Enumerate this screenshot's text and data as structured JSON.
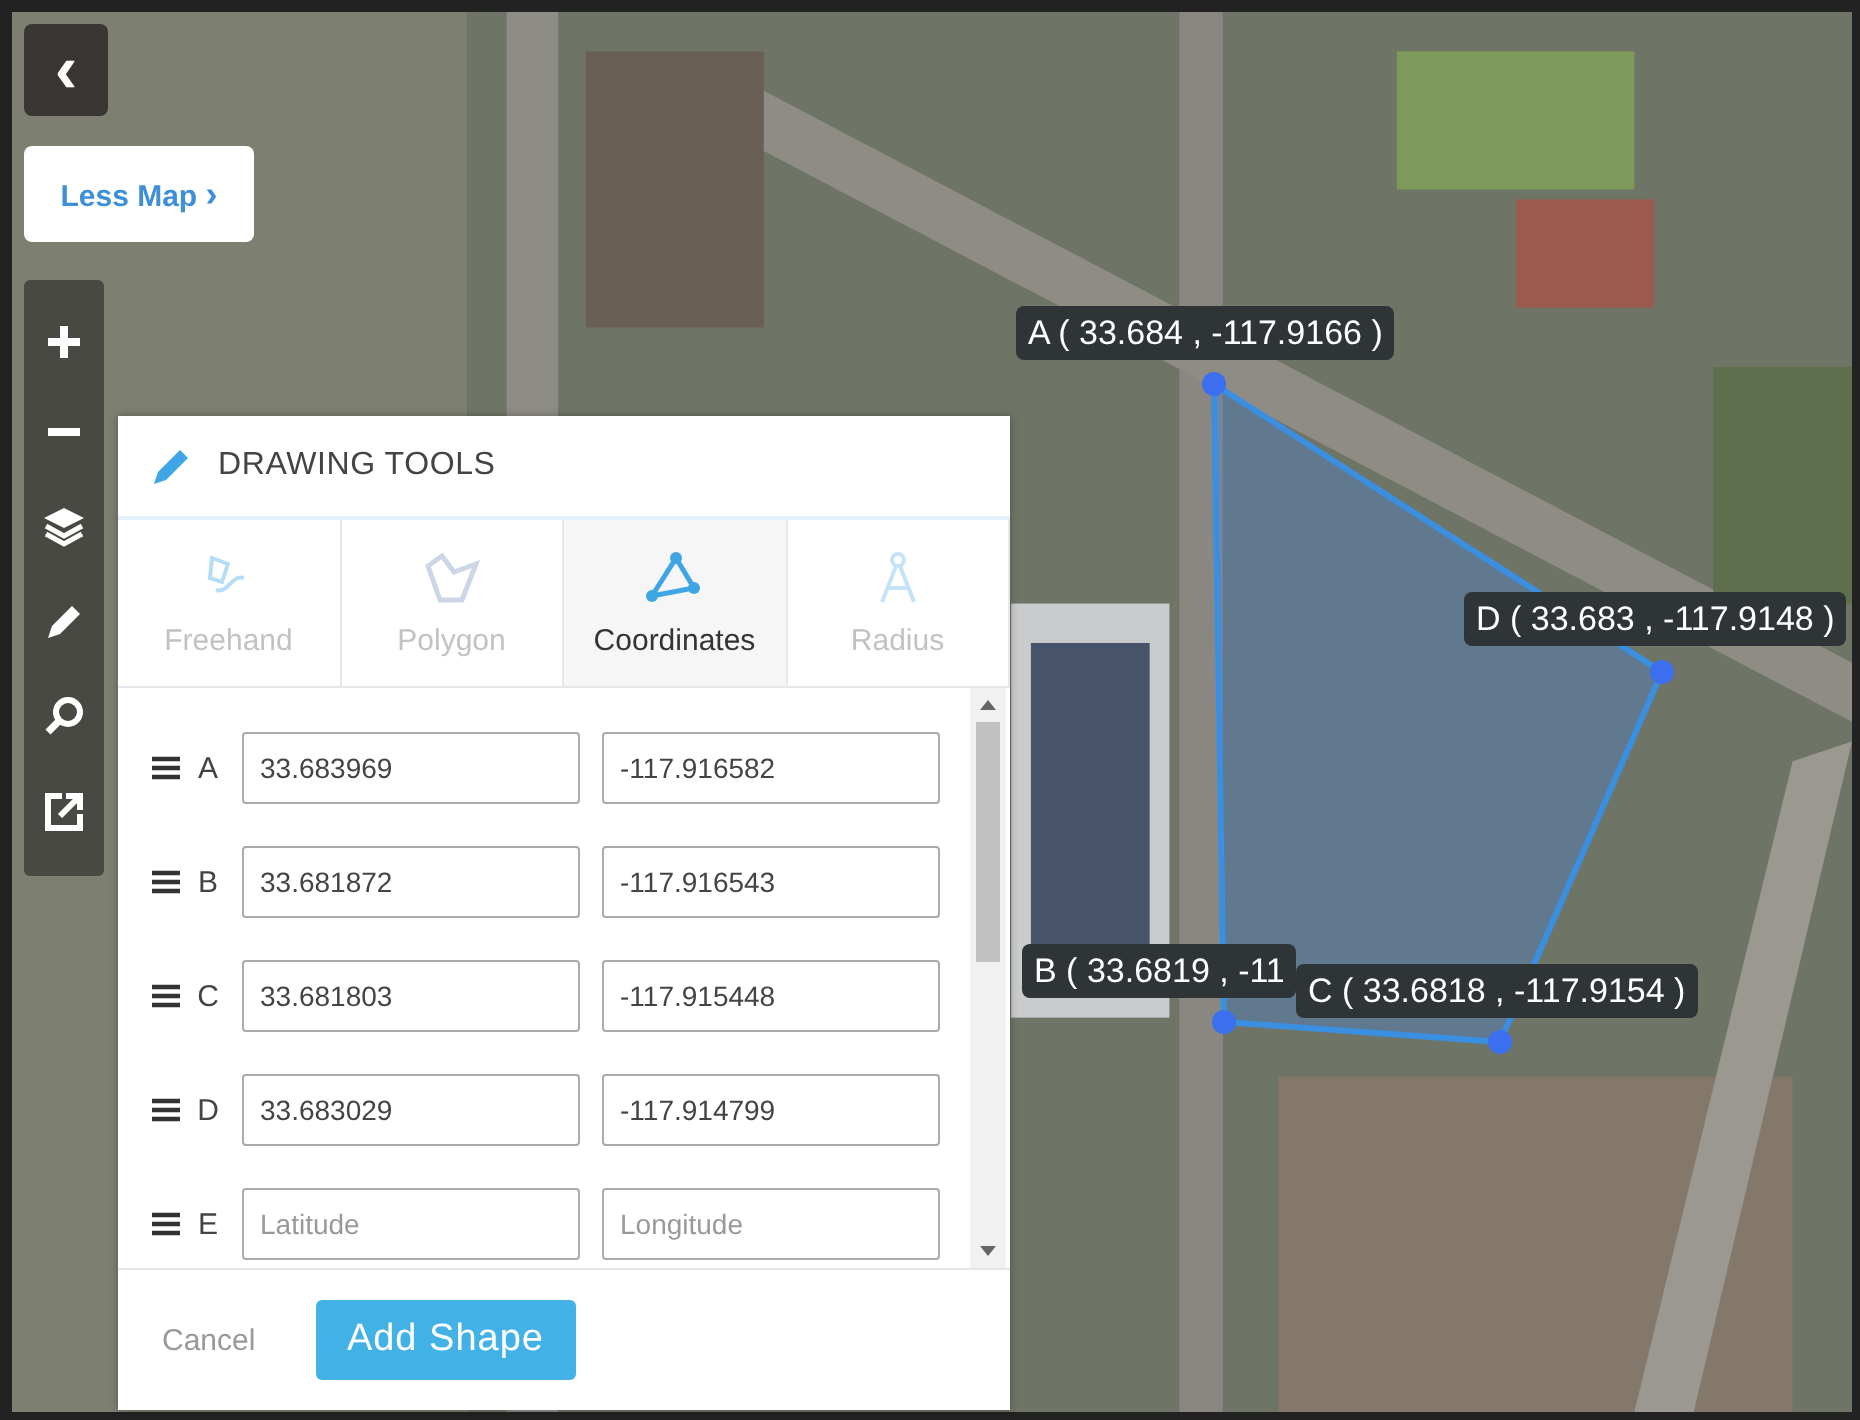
{
  "back_button": {
    "icon": "‹"
  },
  "less_map_button": {
    "label": "Less Map",
    "icon": "›"
  },
  "vertex_labels": [
    {
      "text": "A ( 33.684 , -117.9166 )"
    },
    {
      "text": "D ( 33.683 , -117.9148 )"
    },
    {
      "text": "B ( 33.6819 , -11"
    },
    {
      "text": "C ( 33.6818 , -117.9154 )"
    }
  ],
  "panel": {
    "title": "DRAWING TOOLS",
    "tabs": [
      {
        "label": "Freehand",
        "kind": "freehand",
        "selected": false
      },
      {
        "label": "Polygon",
        "kind": "polygon",
        "selected": false
      },
      {
        "label": "Coordinates",
        "kind": "coordinates",
        "selected": true
      },
      {
        "label": "Radius",
        "kind": "radius",
        "selected": false
      }
    ],
    "points": [
      {
        "letter": "A",
        "latitude": "33.683969",
        "longitude": "-117.916582"
      },
      {
        "letter": "B",
        "latitude": "33.681872",
        "longitude": "-117.916543"
      },
      {
        "letter": "C",
        "latitude": "33.681803",
        "longitude": "-117.915448"
      },
      {
        "letter": "D",
        "latitude": "33.683029",
        "longitude": "-117.914799"
      },
      {
        "letter": "E",
        "latitude_placeholder": "Latitude",
        "longitude_placeholder": "Longitude"
      }
    ],
    "cancel": "Cancel",
    "add": "Add Shape"
  }
}
